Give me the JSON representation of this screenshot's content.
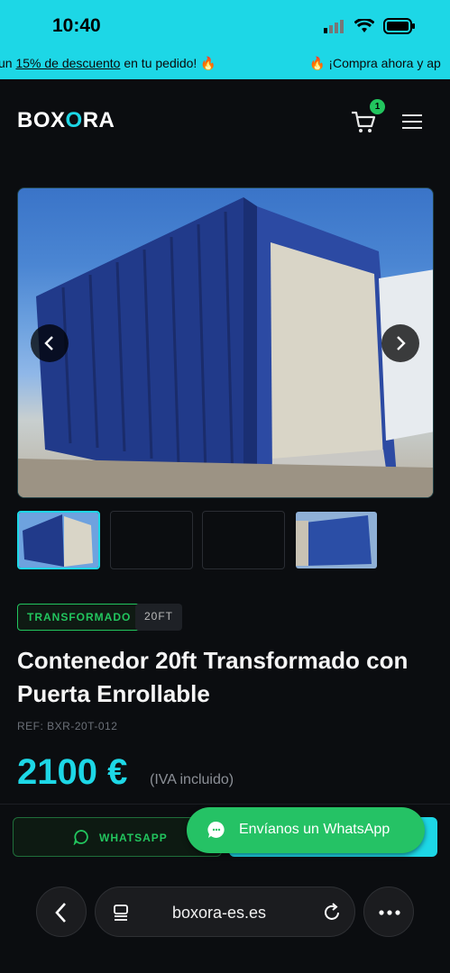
{
  "status_bar": {
    "time": "10:40"
  },
  "promo": {
    "seg1_prefix": "un ",
    "seg1_link": "15% de descuento",
    "seg1_suffix": " en tu pedido! 🔥",
    "seg2": "🔥 ¡Compra ahora y ap"
  },
  "header": {
    "logo_part1": "BOX",
    "logo_o": "O",
    "logo_part2": "RA",
    "cart_count": "1"
  },
  "product": {
    "badge_type": "TRANSFORMADO",
    "badge_size": "20FT",
    "title": "Contenedor 20ft Transformado con Puerta Enrollable",
    "ref": "REF: BXR-20T-012",
    "price": "2100 €",
    "price_note": "(IVA incluido)"
  },
  "actions": {
    "whatsapp_label": "WHATSAPP",
    "float_label": "Envíanos un WhatsApp"
  },
  "browser": {
    "url": "boxora-es.es"
  },
  "colors": {
    "accent": "#1dd7e6",
    "green": "#22c55e",
    "background": "#0b0d10"
  }
}
